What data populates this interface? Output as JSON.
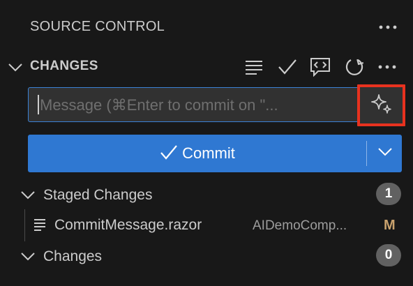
{
  "header": {
    "title": "SOURCE CONTROL",
    "more_icon": "ellipsis-icon"
  },
  "changes_section": {
    "title": "CHANGES",
    "toolbar_icons": [
      "view-as-tree-icon",
      "check-icon",
      "comment-code-icon",
      "refresh-icon",
      "ellipsis-icon"
    ]
  },
  "commit_input": {
    "placeholder": "Message (⌘Enter to commit on \"...",
    "value": "",
    "sparkle_icon": "sparkle-icon",
    "highlight_color": "#e8321f"
  },
  "commit_button": {
    "label": "Commit",
    "icon": "check-icon",
    "dropdown_icon": "chevron-down-icon",
    "color": "#2f78d2"
  },
  "staged": {
    "label": "Staged Changes",
    "count": "1",
    "files": [
      {
        "name": "CommitMessage.razor",
        "path": "AIDemoComp...",
        "status": "M"
      }
    ]
  },
  "changes": {
    "label": "Changes",
    "count": "0"
  }
}
